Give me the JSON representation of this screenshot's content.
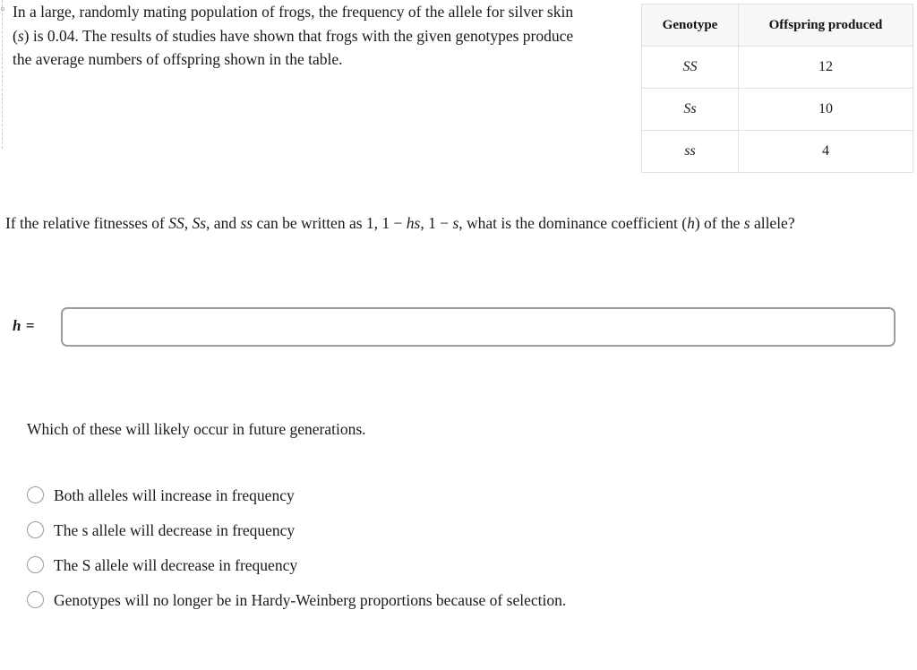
{
  "margin": {
    "marker_glyph": "o"
  },
  "intro": {
    "line1": "In a large, randomly mating population of frogs, the frequency of the allele for silver skin",
    "line2_a": "(",
    "line2_italic": "s",
    "line2_b": ") is 0.04. The results of studies have shown that frogs with the given genotypes produce",
    "line3": "the average numbers of offspring shown in the table."
  },
  "table": {
    "headers": [
      "Genotype",
      "Offspring produced"
    ],
    "rows": [
      {
        "genotype": "SS",
        "offspring": "12"
      },
      {
        "genotype": "Ss",
        "offspring": "10"
      },
      {
        "genotype": "ss",
        "offspring": "4"
      }
    ]
  },
  "question": {
    "p1": "If the relative fitnesses of ",
    "g1": "SS, Ss,",
    "p2": " and ",
    "g2": "ss",
    "p3": " can be written as 1,  1 − ",
    "g3": "hs",
    "p4": ",  1 − ",
    "g4": "s",
    "p5": ", what is the dominance coefficient (",
    "g5": "h",
    "p6": ") of the ",
    "g6": "s",
    "p7": " allele?"
  },
  "answer": {
    "label": "h =",
    "value": "",
    "placeholder": ""
  },
  "multiple_choice": {
    "prompt": "Which of these will likely occur in future generations.",
    "options": [
      {
        "label": "Both alleles will increase in frequency",
        "selected": false
      },
      {
        "label": "The s allele will decrease in frequency",
        "selected": false
      },
      {
        "label": "The S allele will decrease in frequency",
        "selected": false
      },
      {
        "label": "Genotypes will no longer be in Hardy-Weinberg proportions because of selection.",
        "selected": false
      }
    ]
  },
  "colors": {
    "text": "#1a1a1a",
    "table_border": "#e2e2e2",
    "table_header_bg": "#f7f7f7",
    "input_border": "#9c9c9c",
    "radio_border": "#9a9a9a"
  }
}
